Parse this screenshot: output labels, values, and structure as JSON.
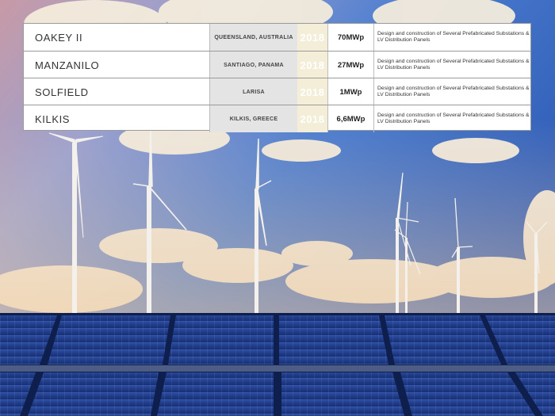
{
  "projects": [
    {
      "name": "OAKEY II",
      "location": "QUEENSLAND, AUSTRALIA",
      "year": "2018",
      "power": "70MWp",
      "description": "Design and construction of Several Prefabricated Substations & LV Distribution Panels"
    },
    {
      "name": "MANZANILO",
      "location": "SANTIAGO, PANAMA",
      "year": "2018",
      "power": "27MWp",
      "description": "Design and construction of Several Prefabricated Substations & LV Distribution Panels"
    },
    {
      "name": "SOLFIELD",
      "location": "LARISA",
      "year": "2018",
      "power": "1MWp",
      "description": "Design and construction of Several Prefabricated Substations & LV Distribution Panels"
    },
    {
      "name": "KILKIS",
      "location": "KILKIS, GREECE",
      "year": "2018",
      "power": "6,6MWp",
      "description": "Design and construction of Several Prefabricated Substations & LV Distribution Panels"
    }
  ],
  "colors": {
    "sky_top": "#5a86c9",
    "sky_mid": "#6f96d0",
    "panel_blue": "#1f3f8f",
    "table_border": "#9a9a9a"
  }
}
